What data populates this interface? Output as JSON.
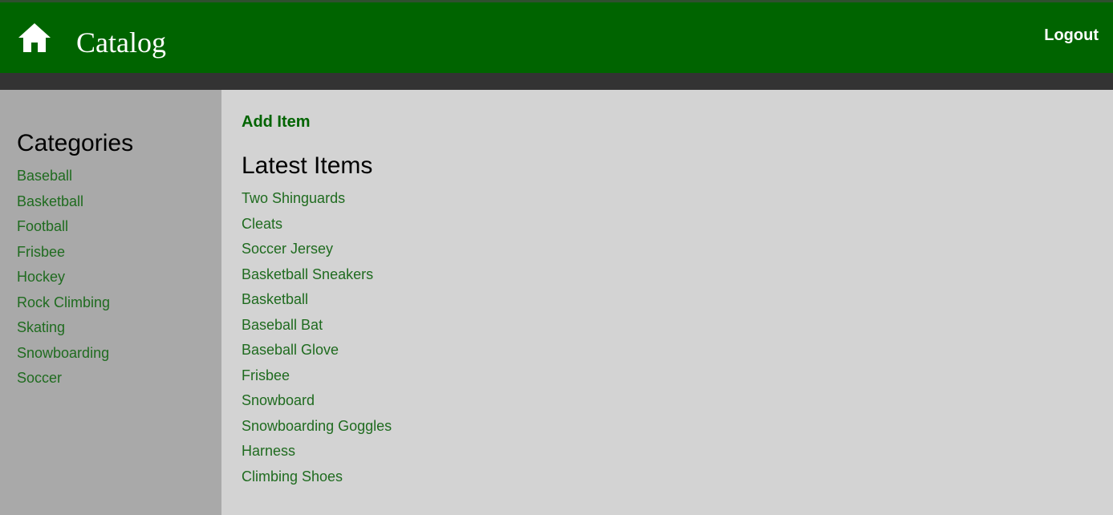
{
  "header": {
    "brand": "Catalog",
    "logout_label": "Logout",
    "home_icon": "home-icon",
    "colors": {
      "header_bg": "#006400",
      "subbar_bg": "#333333"
    }
  },
  "sidebar": {
    "title": "Categories",
    "categories": [
      "Baseball",
      "Basketball",
      "Football",
      "Frisbee",
      "Hockey",
      "Rock Climbing",
      "Skating",
      "Snowboarding",
      "Soccer"
    ]
  },
  "main": {
    "add_item_label": "Add Item",
    "title": "Latest Items",
    "items": [
      "Two Shinguards",
      "Cleats",
      "Soccer Jersey",
      "Basketball Sneakers",
      "Basketball",
      "Baseball Bat",
      "Baseball Glove",
      "Frisbee",
      "Snowboard",
      "Snowboarding Goggles",
      "Harness",
      "Climbing Shoes"
    ],
    "colors": {
      "link": "#1f6b1f",
      "content_bg": "#d3d3d3",
      "sidebar_bg": "#a9a9a9"
    }
  }
}
